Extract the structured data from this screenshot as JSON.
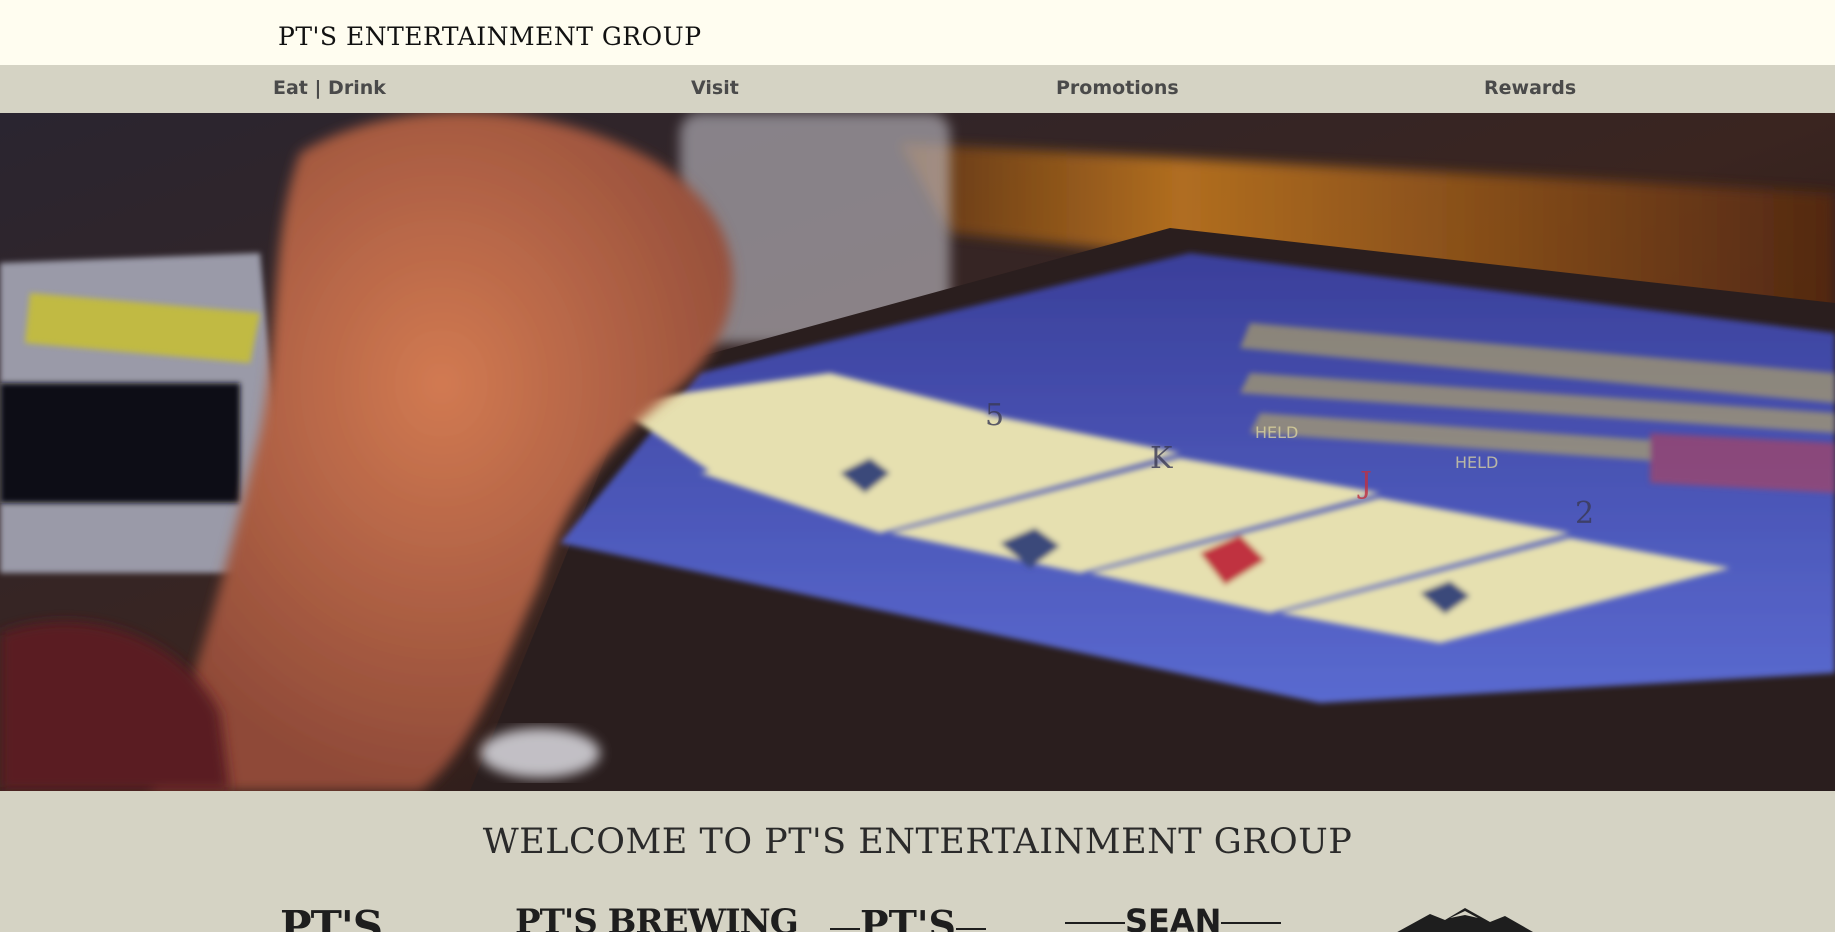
{
  "header": {
    "brand": "PT'S ENTERTAINMENT GROUP"
  },
  "nav": {
    "items": [
      {
        "label": "Eat | Drink"
      },
      {
        "label": "Visit"
      },
      {
        "label": "Promotions"
      },
      {
        "label": "Rewards"
      }
    ]
  },
  "hero": {
    "image": "video-poker-machine-photo",
    "card_ranks": [
      "5",
      "K",
      "J",
      "2"
    ],
    "screen_labels": [
      "HELD",
      "HELD"
    ]
  },
  "welcome": {
    "title": "WELCOME TO PT'S ENTERTAINMENT GROUP"
  },
  "logos": {
    "items": [
      {
        "text": "PT'S"
      },
      {
        "text": "PT'S BREWING"
      },
      {
        "text": "PT'S"
      },
      {
        "text": "SEAN"
      },
      {
        "icon": "mountain-logo-icon"
      }
    ]
  },
  "colors": {
    "topbar_bg": "#fffdf0",
    "nav_bg": "#d5d3c4",
    "text_dark": "#111111",
    "nav_text": "#4a4a4a"
  }
}
